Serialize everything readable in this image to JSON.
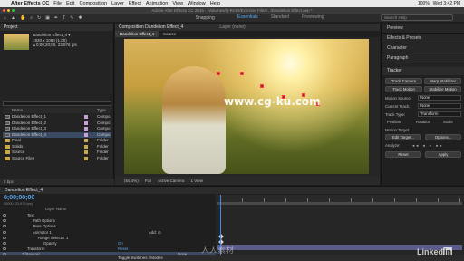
{
  "menubar": {
    "app_name": "After Effects CC",
    "menus": [
      "File",
      "Edit",
      "Composition",
      "Layer",
      "Effect",
      "Animation",
      "View",
      "Window",
      "Help"
    ],
    "status": [
      "100%",
      "Wed 3:42 PM"
    ]
  },
  "titlebar": {
    "path": "Adobe After Effects CC 2015 - /Volumes/Q-RAID/Exercise Files/.../Dandelion Effect.aep *"
  },
  "workspace": {
    "tools_label": "Snapping",
    "items": [
      "Essentials",
      "Standard",
      "Previewing"
    ],
    "active": "Essentials",
    "search_placeholder": "Search Help"
  },
  "project": {
    "title": "Project",
    "selected_name": "Dandelion Effect_4 ▾",
    "info_lines": [
      "1920 x 1080 (1.00)",
      "Δ 0;00;20;00, 23.976 fps"
    ],
    "columns": [
      "Name",
      "Type"
    ],
    "items": [
      {
        "name": "Dandelion Effect_1",
        "type": "Compo",
        "folder": false
      },
      {
        "name": "Dandelion Effect_2",
        "type": "Compo",
        "folder": false
      },
      {
        "name": "Dandelion Effect_3",
        "type": "Compo",
        "folder": false
      },
      {
        "name": "Dandelion Effect_4",
        "type": "Compo",
        "folder": false
      },
      {
        "name": "Final",
        "type": "Folder",
        "folder": true
      },
      {
        "name": "Solids",
        "type": "Folder",
        "folder": true
      },
      {
        "name": "Source",
        "type": "Folder",
        "folder": true
      },
      {
        "name": "Source Files",
        "type": "Folder",
        "folder": true
      }
    ],
    "footer": "8 bpc",
    "label_colors": [
      "#c9a0dc",
      "#c9a0dc",
      "#c9a0dc",
      "#c9a0dc",
      "#c9a84a",
      "#c9a84a",
      "#c9a84a",
      "#c9a84a"
    ]
  },
  "composition": {
    "panel_title": "Composition Dandelion Effect_4",
    "layer_tab": "Layer (none)",
    "tabs": [
      "Dandelion Effect_4",
      "Source"
    ],
    "watermark": "www.cg-ku.com",
    "bottom_bar": [
      "(50.4%)",
      "Full",
      "Active Camera",
      "1 View"
    ]
  },
  "right_panels": {
    "collapsed": [
      "Preview",
      "Effects & Presets",
      "Character",
      "Paragraph"
    ],
    "tracker": {
      "title": "Tracker",
      "buttons": [
        "Track Camera",
        "Warp Stabilizer",
        "Track Motion",
        "Stabilize Motion"
      ],
      "motion_source_label": "Motion Source:",
      "motion_source_value": "None",
      "current_track_label": "Current Track:",
      "current_track_value": "None",
      "track_type_label": "Track Type:",
      "track_type_value": "Transform",
      "options": [
        "Position",
        "Rotation",
        "Scale"
      ],
      "motion_target_label": "Motion Target:",
      "edit_target": "Edit Target...",
      "options_button": "Options...",
      "analyze_label": "Analyze:",
      "reset": "Reset",
      "apply": "Apply"
    }
  },
  "timeline": {
    "tab": "Dandelion Effect_4",
    "timecode": "0;00;00;00",
    "timecode_sub": "00000 (23.976 fps)",
    "columns_label": "Layer Name",
    "layers": [
      {
        "name": "Text",
        "indent": 1
      },
      {
        "name": "Path Options",
        "indent": 2
      },
      {
        "name": "More Options",
        "indent": 2
      },
      {
        "name": "Animator 1",
        "indent": 2
      },
      {
        "name": "Range Selector 1",
        "indent": 3
      },
      {
        "name": "Opacity",
        "indent": 4
      },
      {
        "name": "Transform",
        "indent": 1
      },
      {
        "name": "3 [Source]",
        "indent": 0
      }
    ],
    "add_label": "Add: ⊙",
    "on_label": "On",
    "reset_label": "Reset",
    "none_label": "None",
    "toggle": "Toggle Switches / Modes",
    "watermark": "人人素材",
    "brand": "Linked",
    "brand_in": "in"
  }
}
